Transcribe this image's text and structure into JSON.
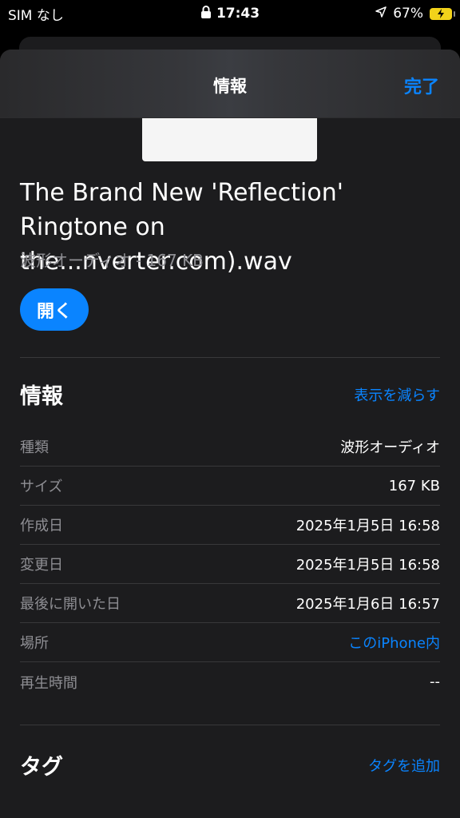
{
  "status": {
    "carrier": "SIM なし",
    "time": "17:43",
    "battery": "67%"
  },
  "nav": {
    "title": "情報",
    "done": "完了"
  },
  "file": {
    "name": "The Brand New 'Reflection' Ringtone on the...nverter.com).wav",
    "subtitle": "波形オーディオ - 167 KB",
    "open_label": "開く"
  },
  "info": {
    "title": "情報",
    "toggle": "表示を減らす",
    "rows": [
      {
        "label": "種類",
        "value": "波形オーディオ"
      },
      {
        "label": "サイズ",
        "value": "167 KB"
      },
      {
        "label": "作成日",
        "value": "2025年1月5日 16:58"
      },
      {
        "label": "変更日",
        "value": "2025年1月5日 16:58"
      },
      {
        "label": "最後に開いた日",
        "value": "2025年1月6日 16:57"
      },
      {
        "label": "場所",
        "value": "このiPhone内"
      },
      {
        "label": "再生時間",
        "value": "--"
      }
    ]
  },
  "tags": {
    "title": "タグ",
    "add": "タグを追加"
  },
  "colors": {
    "accent": "#0a84ff",
    "sheet": "#1c1c1e",
    "battery": "#f2d21a"
  }
}
